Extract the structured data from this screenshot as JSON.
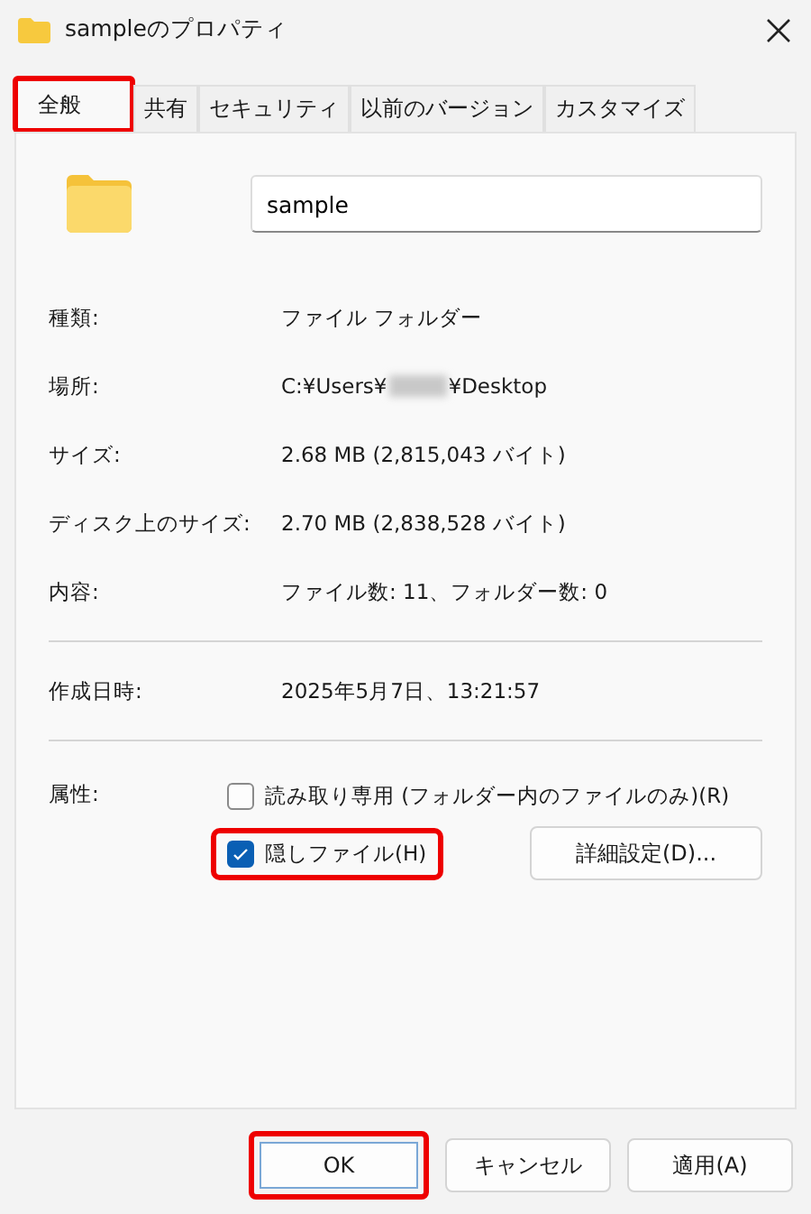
{
  "window": {
    "title": "sampleのプロパティ"
  },
  "tabs": [
    {
      "label": "全般",
      "selected": true,
      "highlighted": true
    },
    {
      "label": "共有",
      "selected": false,
      "highlighted": false
    },
    {
      "label": "セキュリティ",
      "selected": false,
      "highlighted": false
    },
    {
      "label": "以前のバージョン",
      "selected": false,
      "highlighted": false
    },
    {
      "label": "カスタマイズ",
      "selected": false,
      "highlighted": false
    }
  ],
  "name_field": {
    "value": "sample"
  },
  "properties": [
    {
      "label": "種類:",
      "value": "ファイル フォルダー"
    },
    {
      "label": "場所:",
      "value": "C:¥Users¥",
      "value_after": "¥Desktop",
      "redacted": true
    },
    {
      "label": "サイズ:",
      "value": "2.68 MB (2,815,043 バイト)"
    },
    {
      "label": "ディスク上のサイズ:",
      "value": "2.70 MB (2,838,528 バイト)"
    },
    {
      "label": "内容:",
      "value": "ファイル数: 11、フォルダー数: 0"
    }
  ],
  "created": {
    "label": "作成日時:",
    "value": "2025年5月7日、13:21:57"
  },
  "attributes": {
    "label": "属性:",
    "checkboxes": [
      {
        "label": "読み取り専用 (フォルダー内のファイルのみ)(R)",
        "checked": false,
        "highlighted": false
      },
      {
        "label": "隠しファイル(H)",
        "checked": true,
        "highlighted": true
      }
    ],
    "advanced_button": "詳細設定(D)..."
  },
  "buttons": [
    {
      "label": "OK",
      "default": true,
      "highlighted": true
    },
    {
      "label": "キャンセル",
      "default": false,
      "highlighted": false
    },
    {
      "label": "適用(A)",
      "default": false,
      "highlighted": false
    }
  ]
}
